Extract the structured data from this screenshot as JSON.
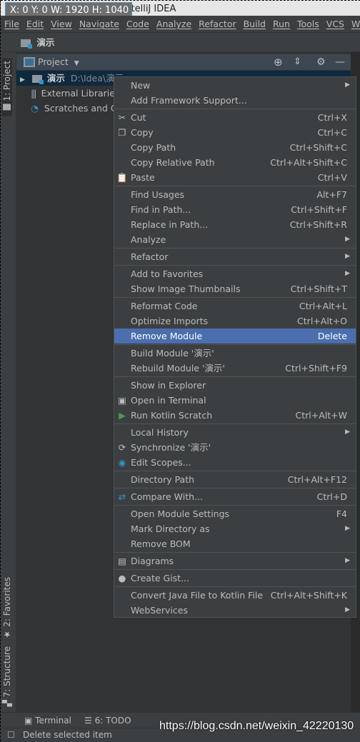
{
  "window": {
    "title": "演示 [D:\\Idea\\演示] - IntelliJ IDEA",
    "overlay": "X: 0 Y: 0 W: 1920 H: 1040"
  },
  "menubar": [
    "File",
    "Edit",
    "View",
    "Navigate",
    "Code",
    "Analyze",
    "Refactor",
    "Build",
    "Run",
    "Tools",
    "VCS",
    "W"
  ],
  "navbar": {
    "project": "演示"
  },
  "side_tabs": {
    "project": "1: Project",
    "favorites": "2: Favorites",
    "structure": "7: Structure"
  },
  "panel": {
    "title": "Project",
    "tree": [
      {
        "name": "演示",
        "path": "D:\\Idea\\演示"
      },
      {
        "name": "External Libraries"
      },
      {
        "name": "Scratches and Consoles"
      }
    ]
  },
  "context_menu": [
    [
      {
        "label": "New",
        "submenu": true
      },
      {
        "label": "Add Framework Support..."
      }
    ],
    [
      {
        "label": "Cut",
        "shortcut": "Ctrl+X",
        "icon": "scissors-icon",
        "glyph": "✂"
      },
      {
        "label": "Copy",
        "shortcut": "Ctrl+C",
        "icon": "copy-icon",
        "glyph": "❐"
      },
      {
        "label": "Copy Path",
        "shortcut": "Ctrl+Shift+C"
      },
      {
        "label": "Copy Relative Path",
        "shortcut": "Ctrl+Alt+Shift+C"
      },
      {
        "label": "Paste",
        "shortcut": "Ctrl+V",
        "icon": "clipboard-icon",
        "glyph": "📋"
      }
    ],
    [
      {
        "label": "Find Usages",
        "shortcut": "Alt+F7"
      },
      {
        "label": "Find in Path...",
        "shortcut": "Ctrl+Shift+F"
      },
      {
        "label": "Replace in Path...",
        "shortcut": "Ctrl+Shift+R"
      },
      {
        "label": "Analyze",
        "submenu": true
      }
    ],
    [
      {
        "label": "Refactor",
        "submenu": true
      }
    ],
    [
      {
        "label": "Add to Favorites",
        "submenu": true
      },
      {
        "label": "Show Image Thumbnails",
        "shortcut": "Ctrl+Shift+T"
      }
    ],
    [
      {
        "label": "Reformat Code",
        "shortcut": "Ctrl+Alt+L"
      },
      {
        "label": "Optimize Imports",
        "shortcut": "Ctrl+Alt+O"
      },
      {
        "label": "Remove Module",
        "shortcut": "Delete",
        "selected": true
      }
    ],
    [
      {
        "label": "Build Module '演示'"
      },
      {
        "label": "Rebuild Module '演示'",
        "shortcut": "Ctrl+Shift+F9"
      }
    ],
    [
      {
        "label": "Show in Explorer"
      },
      {
        "label": "Open in Terminal",
        "icon": "terminal-icon",
        "glyph": "▣"
      },
      {
        "label": "Run Kotlin Scratch",
        "shortcut": "Ctrl+Alt+W",
        "icon": "run-icon",
        "glyph": "▶",
        "color": "#499c54"
      }
    ],
    [
      {
        "label": "Local History",
        "submenu": true
      },
      {
        "label": "Synchronize '演示'",
        "icon": "sync-icon",
        "glyph": "⟳"
      },
      {
        "label": "Edit Scopes...",
        "icon": "scope-icon",
        "glyph": "◉",
        "color": "#3592c4"
      }
    ],
    [
      {
        "label": "Directory Path",
        "shortcut": "Ctrl+Alt+F12"
      }
    ],
    [
      {
        "label": "Compare With...",
        "shortcut": "Ctrl+D",
        "icon": "compare-icon",
        "glyph": "⇄",
        "color": "#3592c4"
      }
    ],
    [
      {
        "label": "Open Module Settings",
        "shortcut": "F4"
      },
      {
        "label": "Mark Directory as",
        "submenu": true
      },
      {
        "label": "Remove BOM"
      }
    ],
    [
      {
        "label": "Diagrams",
        "submenu": true,
        "icon": "diagram-icon",
        "glyph": "▤"
      }
    ],
    [
      {
        "label": "Create Gist...",
        "icon": "github-icon",
        "glyph": "●"
      }
    ],
    [
      {
        "label": "Convert Java File to Kotlin File",
        "shortcut": "Ctrl+Alt+Shift+K"
      },
      {
        "label": "WebServices",
        "submenu": true
      }
    ]
  ],
  "bottom_tabs": {
    "terminal": "Terminal",
    "todo": "6: TODO"
  },
  "status": {
    "text": "Delete selected item"
  },
  "watermark": "https://blog.csdn.net/weixin_42220130",
  "colors": {
    "selection": "#4b6eaf",
    "menu_bg": "#3c3f41",
    "tree_selection": "#0d293e"
  }
}
